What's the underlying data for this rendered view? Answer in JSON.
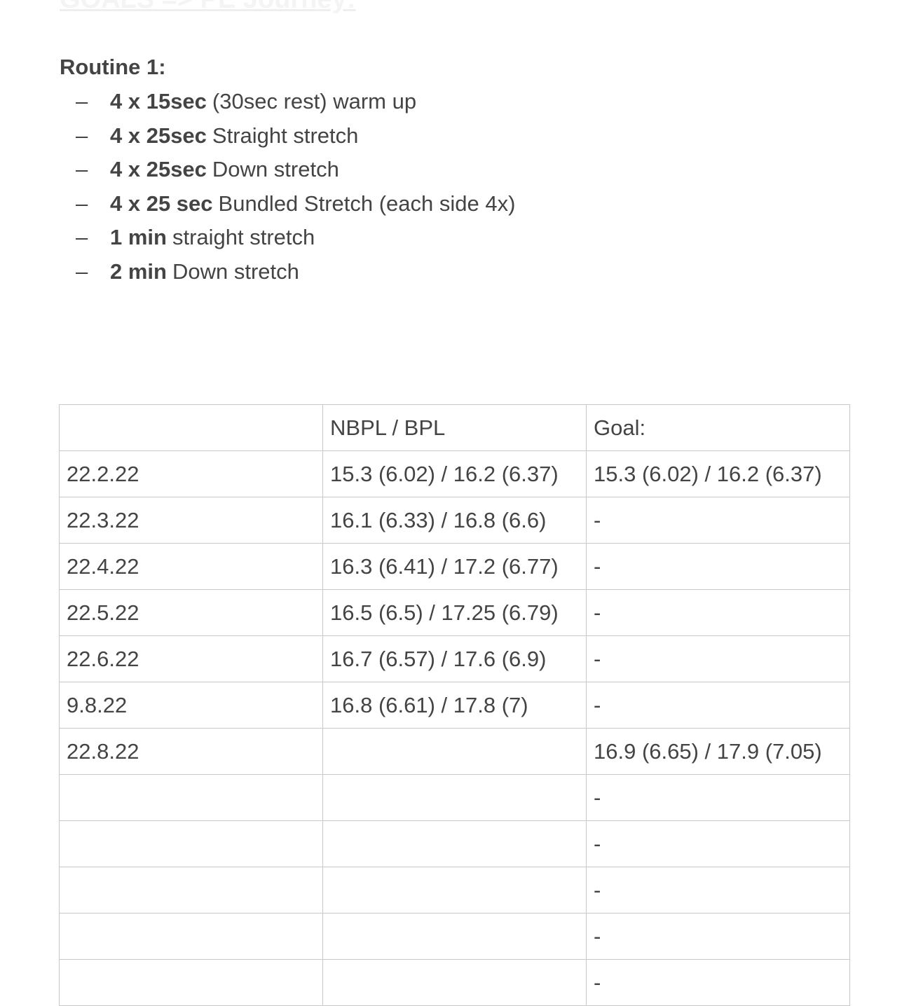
{
  "heading": "GOALS => PE Journey:",
  "routine": {
    "title": "Routine 1:",
    "items": [
      {
        "bold": "4 x 15sec",
        "text": "(30sec rest) warm up"
      },
      {
        "bold": "4 x 25sec",
        "text": "Straight stretch"
      },
      {
        "bold": "4 x 25sec",
        "text": "Down stretch"
      },
      {
        "bold": "4 x 25 sec",
        "text": "Bundled Stretch (each side 4x)"
      },
      {
        "bold": "1 min",
        "text": "straight stretch"
      },
      {
        "bold": "2 min",
        "text": "Down stretch"
      }
    ]
  },
  "table": {
    "headers": [
      "",
      "NBPL / BPL",
      "Goal:"
    ],
    "rows": [
      [
        "22.2.22",
        "15.3 (6.02) / 16.2 (6.37)",
        "15.3 (6.02) / 16.2 (6.37)"
      ],
      [
        "22.3.22",
        "16.1 (6.33) / 16.8 (6.6)",
        "-"
      ],
      [
        "22.4.22",
        "16.3 (6.41) / 17.2 (6.77)",
        "-"
      ],
      [
        "22.5.22",
        "16.5 (6.5) / 17.25 (6.79)",
        "-"
      ],
      [
        "22.6.22",
        "16.7 (6.57) / 17.6 (6.9)",
        "-"
      ],
      [
        "9.8.22",
        "16.8 (6.61) / 17.8 (7)",
        "-"
      ],
      [
        "22.8.22",
        "",
        "16.9 (6.65) / 17.9 (7.05)"
      ],
      [
        "",
        "",
        "-"
      ],
      [
        "",
        "",
        "-"
      ],
      [
        "",
        "",
        "-"
      ],
      [
        "",
        "",
        "-"
      ],
      [
        "",
        "",
        "-"
      ]
    ]
  }
}
